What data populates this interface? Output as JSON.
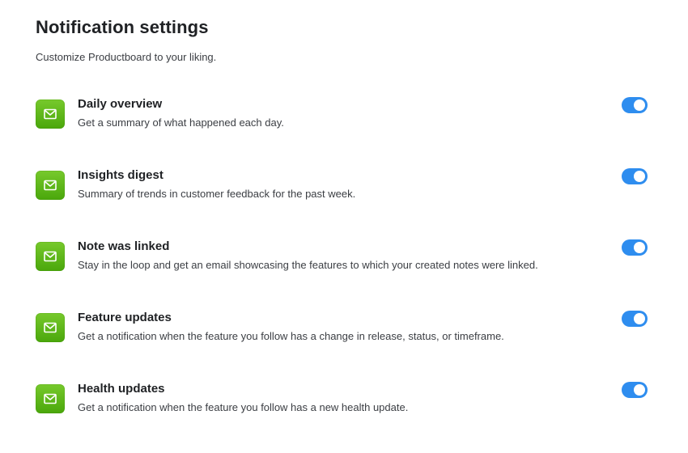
{
  "header": {
    "title": "Notification settings",
    "subtitle": "Customize Productboard to your liking."
  },
  "colors": {
    "toggle_on": "#2e8def",
    "badge_green": "#5fb81a"
  },
  "settings": [
    {
      "icon": "envelope-icon",
      "title": "Daily overview",
      "description": "Get a summary of what happened each day.",
      "enabled": true
    },
    {
      "icon": "envelope-icon",
      "title": "Insights digest",
      "description": "Summary of trends in customer feedback for the past week.",
      "enabled": true
    },
    {
      "icon": "envelope-icon",
      "title": "Note was linked",
      "description": "Stay in the loop and get an email showcasing the features to which your created notes were linked.",
      "enabled": true
    },
    {
      "icon": "envelope-icon",
      "title": "Feature updates",
      "description": "Get a notification when the feature you follow has a change in release, status, or timeframe.",
      "enabled": true
    },
    {
      "icon": "envelope-icon",
      "title": "Health updates",
      "description": "Get a notification when the feature you follow has a new health update.",
      "enabled": true
    }
  ]
}
